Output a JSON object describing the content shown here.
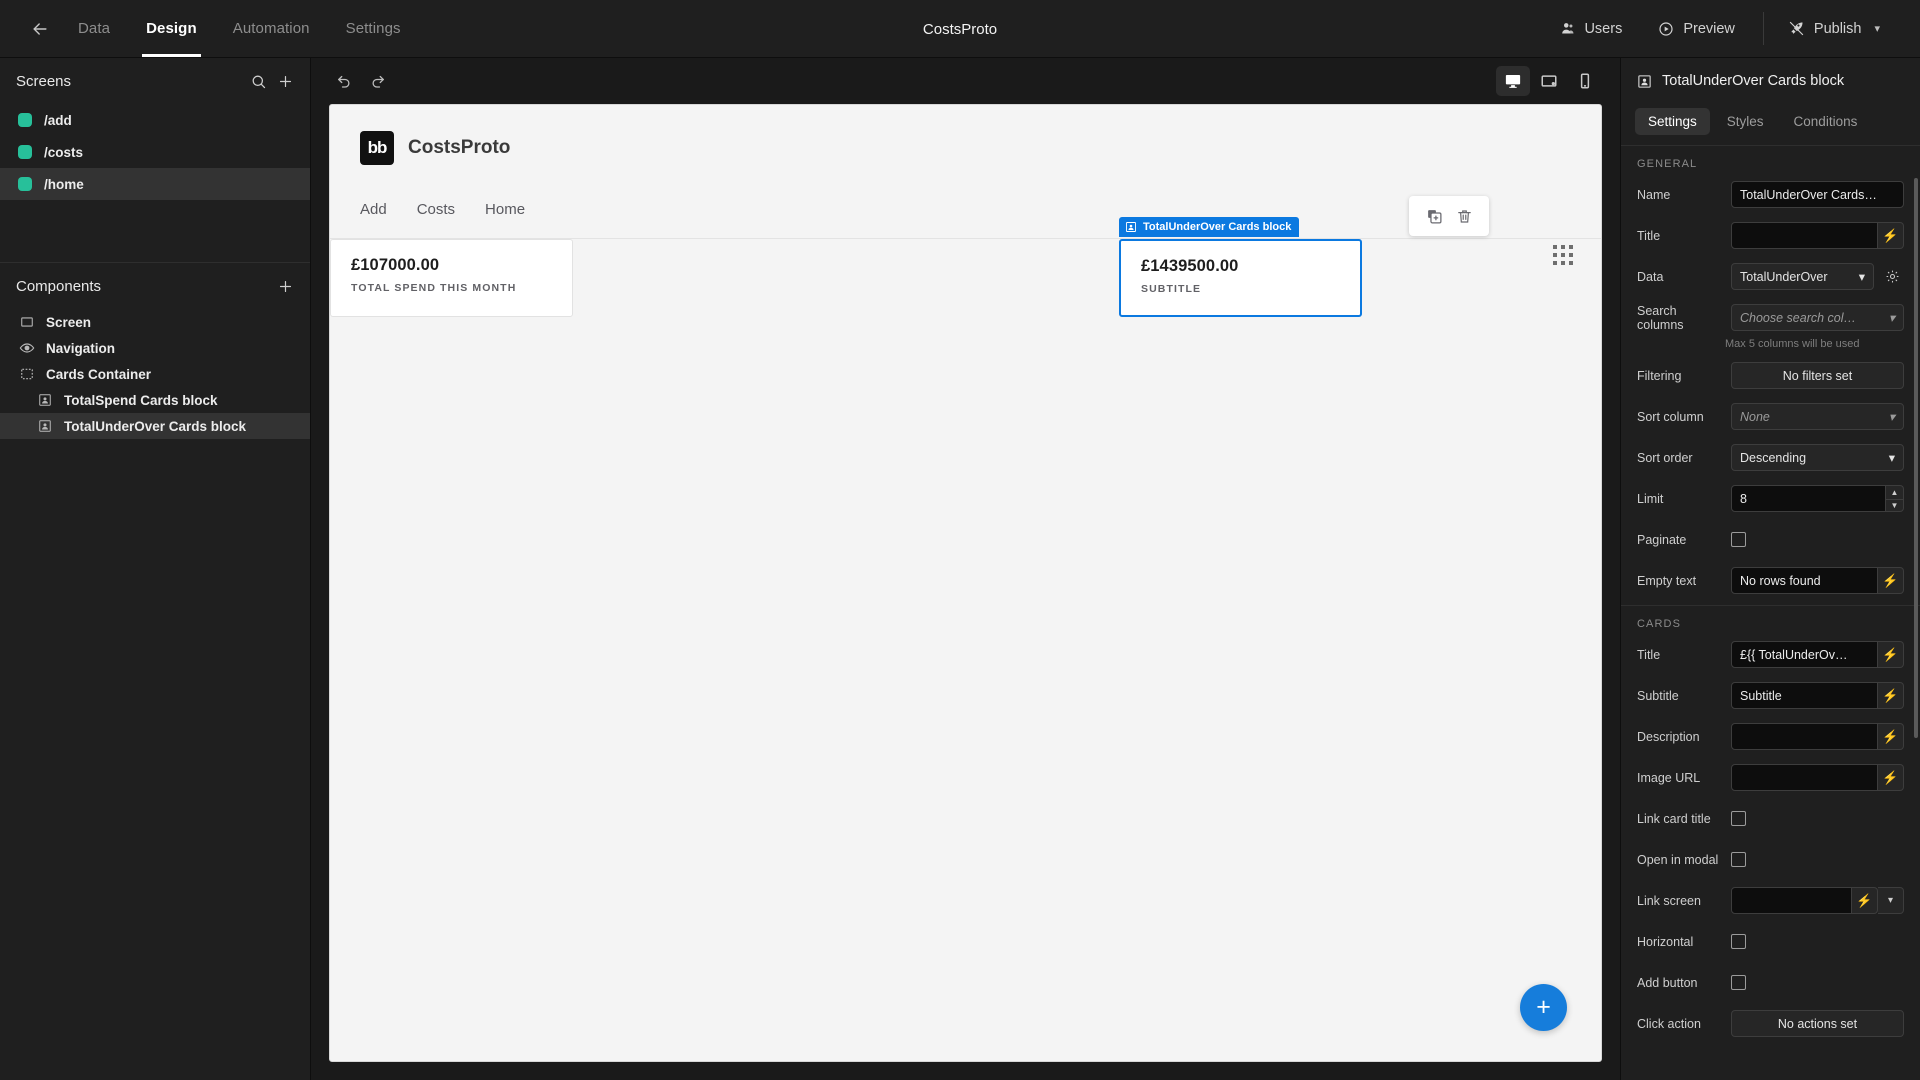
{
  "topbar": {
    "back_icon": "arrow-left-icon",
    "tabs": [
      {
        "label": "Data",
        "active": false
      },
      {
        "label": "Design",
        "active": true
      },
      {
        "label": "Automation",
        "active": false
      },
      {
        "label": "Settings",
        "active": false
      }
    ],
    "app_title": "CostsProto",
    "users_label": "Users",
    "preview_label": "Preview",
    "publish_label": "Publish"
  },
  "left_panel": {
    "screens_title": "Screens",
    "search_icon": "search-icon",
    "add_icon": "plus-icon",
    "screens": [
      {
        "label": "/add",
        "selected": false
      },
      {
        "label": "/costs",
        "selected": false
      },
      {
        "label": "/home",
        "selected": true
      }
    ],
    "components_title": "Components",
    "components_add_icon": "plus-icon",
    "components": [
      {
        "label": "Screen",
        "icon": "screen-icon",
        "indent": false,
        "selected": false
      },
      {
        "label": "Navigation",
        "icon": "eye-icon",
        "indent": false,
        "selected": false
      },
      {
        "label": "Cards Container",
        "icon": "container-icon",
        "indent": false,
        "selected": false
      },
      {
        "label": "TotalSpend Cards block",
        "icon": "block-icon",
        "indent": true,
        "selected": false
      },
      {
        "label": "TotalUnderOver Cards block",
        "icon": "block-icon",
        "indent": true,
        "selected": true
      }
    ]
  },
  "canvas_toolbar": {
    "undo_icon": "undo-icon",
    "redo_icon": "redo-icon",
    "devices": [
      {
        "name": "desktop-icon",
        "active": true
      },
      {
        "name": "tablet-icon",
        "active": false
      },
      {
        "name": "mobile-icon",
        "active": false
      }
    ]
  },
  "preview": {
    "logo_text": "bb",
    "title": "CostsProto",
    "nav_links": [
      "Add",
      "Costs",
      "Home"
    ],
    "grid_handle_icon": "grid-dots-icon",
    "cards": [
      {
        "amount": "£107000.00",
        "subtitle": "TOTAL SPEND THIS MONTH",
        "selected": false
      },
      {
        "amount": "£1439500.00",
        "subtitle": "SUBTITLE",
        "selected": true,
        "badge": "TotalUnderOver Cards block"
      }
    ],
    "edit_toolbar": {
      "duplicate_icon": "duplicate-icon",
      "delete_icon": "trash-icon"
    },
    "fab_icon": "plus-icon"
  },
  "right_panel": {
    "header_title": "TotalUnderOver Cards block",
    "header_icon": "block-icon",
    "tabs": [
      {
        "label": "Settings",
        "active": true
      },
      {
        "label": "Styles",
        "active": false
      },
      {
        "label": "Conditions",
        "active": false
      }
    ],
    "general_section": "GENERAL",
    "name_label": "Name",
    "name_value": "TotalUnderOver Cards…",
    "title_label": "Title",
    "title_value": "",
    "data_label": "Data",
    "data_value": "TotalUnderOver",
    "search_columns_label": "Search columns",
    "search_columns_value": "Choose search col…",
    "search_columns_hint": "Max 5 columns will be used",
    "filtering_label": "Filtering",
    "filtering_value": "No filters set",
    "sort_column_label": "Sort column",
    "sort_column_value": "None",
    "sort_order_label": "Sort order",
    "sort_order_value": "Descending",
    "limit_label": "Limit",
    "limit_value": "8",
    "paginate_label": "Paginate",
    "paginate_checked": false,
    "empty_text_label": "Empty text",
    "empty_text_value": "No rows found",
    "cards_section": "CARDS",
    "card_title_label": "Title",
    "card_title_value": "£{{ TotalUnderOv…",
    "card_subtitle_label": "Subtitle",
    "card_subtitle_value": "Subtitle",
    "card_description_label": "Description",
    "card_description_value": "",
    "image_url_label": "Image URL",
    "image_url_value": "",
    "link_card_title_label": "Link card title",
    "link_card_title_checked": false,
    "open_in_modal_label": "Open in modal",
    "open_in_modal_checked": false,
    "link_screen_label": "Link screen",
    "link_screen_value": "",
    "horizontal_label": "Horizontal",
    "horizontal_checked": false,
    "add_button_label": "Add button",
    "add_button_checked": false,
    "click_action_label": "Click action",
    "click_action_value": "No actions set"
  },
  "colors": {
    "accent_blue": "#0b79e0",
    "screen_dot_green": "#27c09a",
    "panel_bg": "#1f1f1f",
    "canvas_bg": "#f4f4f4"
  }
}
